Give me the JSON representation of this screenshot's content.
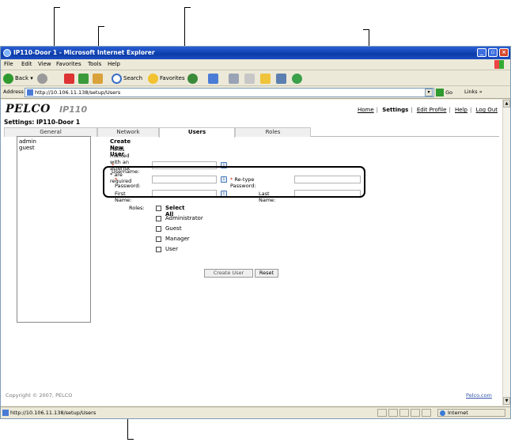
{
  "window": {
    "title": "IP110-Door 1 - Microsoft Internet Explorer",
    "controls": [
      "_",
      "▫",
      "×"
    ]
  },
  "menu": [
    "File",
    "Edit",
    "View",
    "Favorites",
    "Tools",
    "Help"
  ],
  "toolbar": {
    "back": "Back",
    "search": "Search",
    "favorites": "Favorites"
  },
  "address": {
    "label": "Address",
    "url": "http://10.106.11.138/setup/Users",
    "go": "Go",
    "links": "Links"
  },
  "header": {
    "logo": "PELCO",
    "product": "IP110",
    "nav": [
      "Home",
      "Settings",
      "Edit Profile",
      "Help",
      "Log Out"
    ],
    "active_nav": "Settings",
    "settings_title": "Settings: IP110-Door 1"
  },
  "tabs": [
    "General",
    "Network",
    "Users",
    "Roles"
  ],
  "active_tab": "Users",
  "users": [
    "admin",
    "guest"
  ],
  "form": {
    "heading": "Create New User",
    "required_note": "Fields marked with an asterisk * are required",
    "username_label": "Username:",
    "password_label": "Password:",
    "retype_label": "Re-type Password:",
    "first_name_label": "First Name:",
    "last_name_label": "Last Name:",
    "roles_label": "Roles:",
    "roles": [
      "Select All",
      "Administrator",
      "Guest",
      "Manager",
      "User"
    ],
    "create_button": "Create User",
    "reset_button": "Reset"
  },
  "footer": {
    "copyright": "Copyright © 2007, PELCO",
    "link": "Pelco.com"
  },
  "status": {
    "url": "http://10.106.11.138/setup/Users",
    "zone": "Internet"
  }
}
